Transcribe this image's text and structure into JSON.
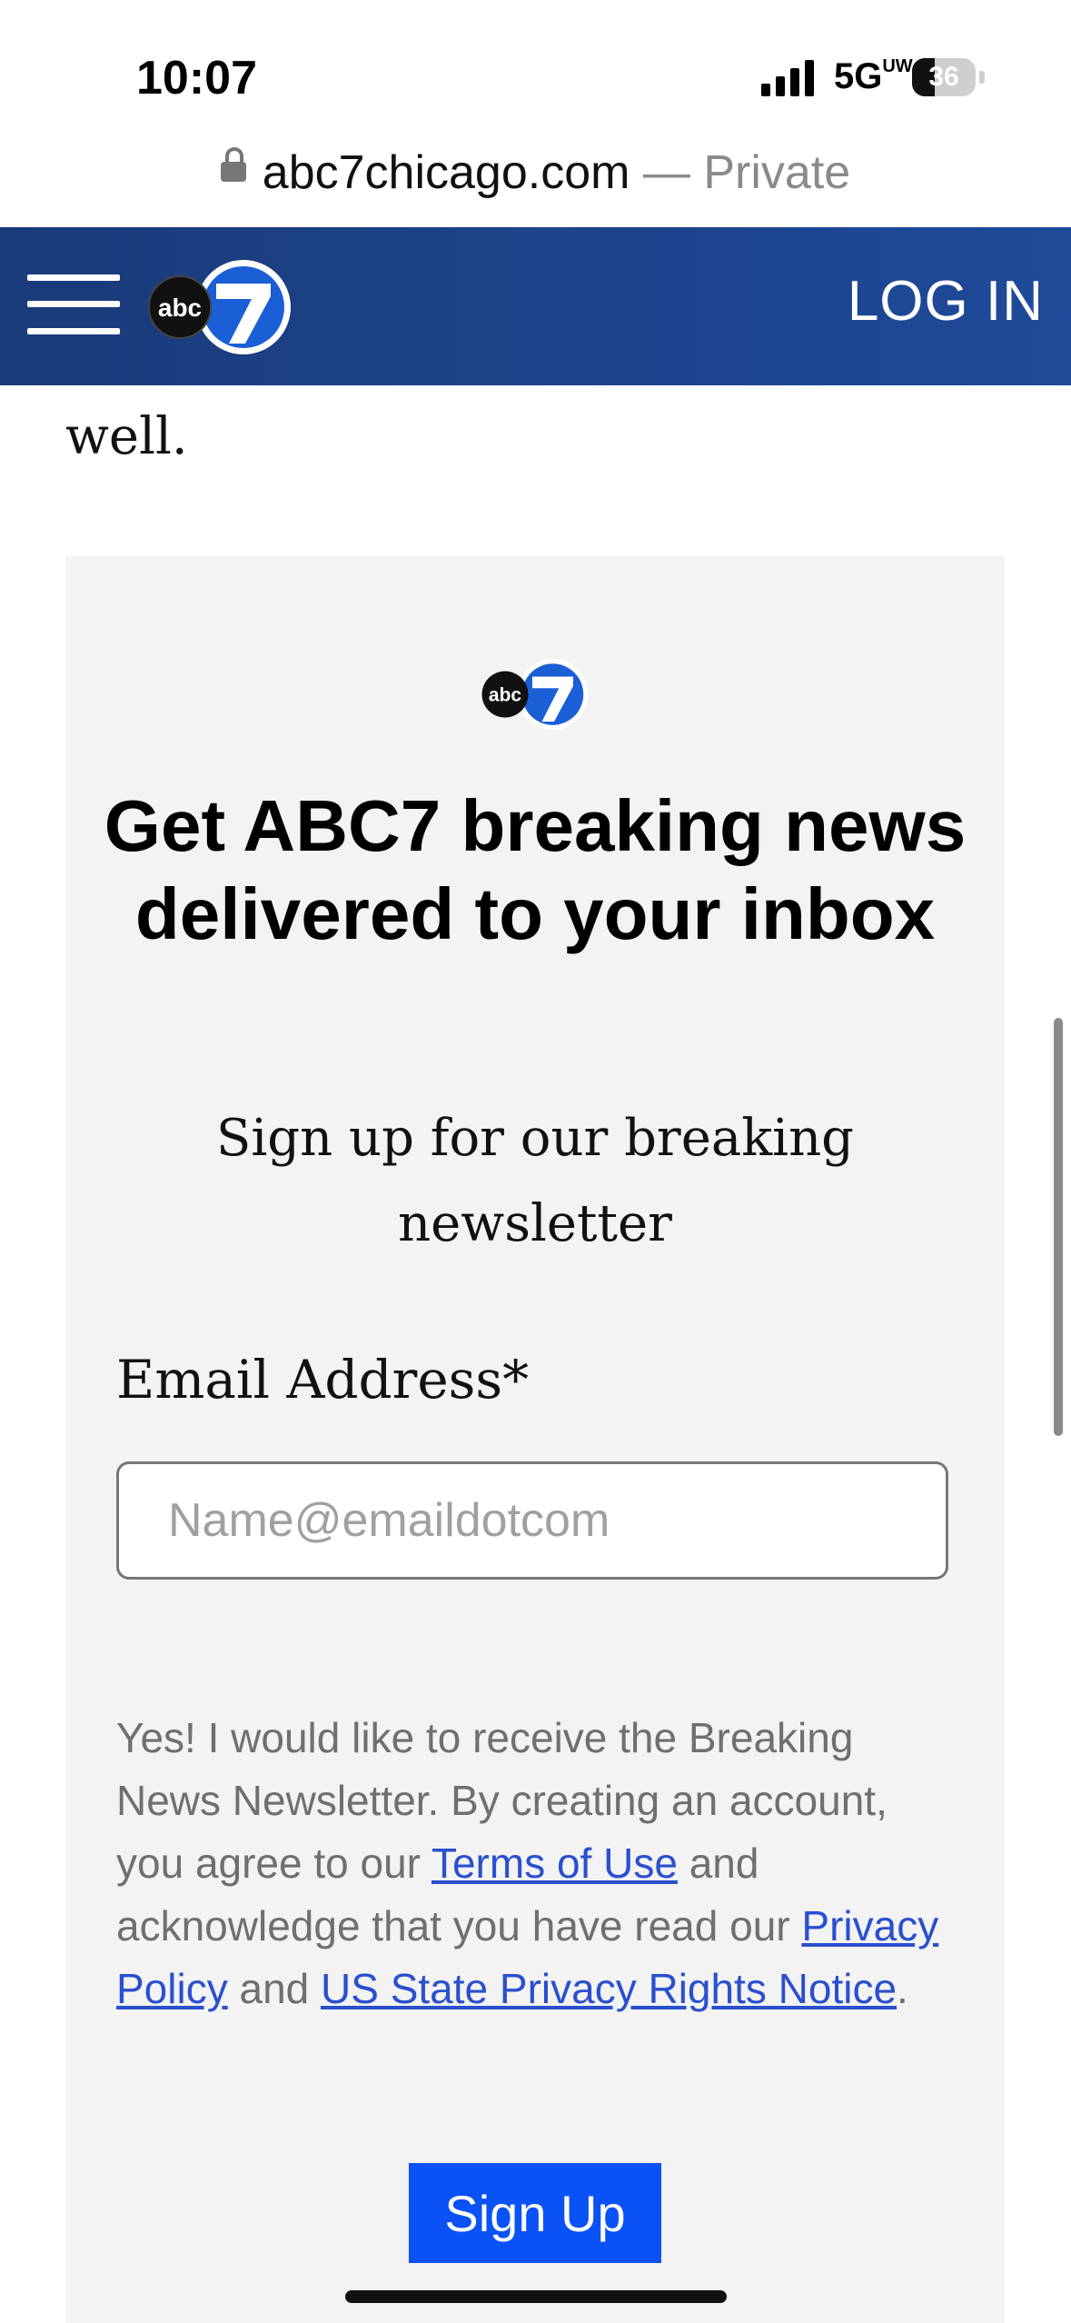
{
  "status_bar": {
    "time": "10:07",
    "network": "5G",
    "network_sup": "UW",
    "battery": "36",
    "battery_level_percent": 36
  },
  "url_bar": {
    "domain": "abc7chicago.com",
    "suffix": " — Private"
  },
  "header": {
    "logo_text": "abc",
    "logo_number": "7",
    "login_label": "LOG IN",
    "bg_color": "#1e4a99"
  },
  "article": {
    "tail_text": "well."
  },
  "newsletter": {
    "logo_text": "abc",
    "logo_number": "7",
    "title": "Get ABC7 breaking news delivered to your inbox",
    "subtitle": "Sign up for our breaking newsletter",
    "email_label": "Email Address*",
    "email_placeholder": "Name@emaildotcom",
    "email_value": "",
    "consent_part1": "Yes! I would like to receive the Breaking News Newsletter. By creating an account, you agree to our ",
    "terms_link": "Terms of Use",
    "consent_part2": " and acknowledge that you have read our ",
    "privacy_link": "Privacy Policy",
    "consent_part3": " and ",
    "state_privacy_link": "US State Privacy Rights Notice",
    "consent_part4": ".",
    "signup_label": "Sign Up",
    "button_color": "#0a52f5",
    "link_color": "#2a4fcf"
  }
}
